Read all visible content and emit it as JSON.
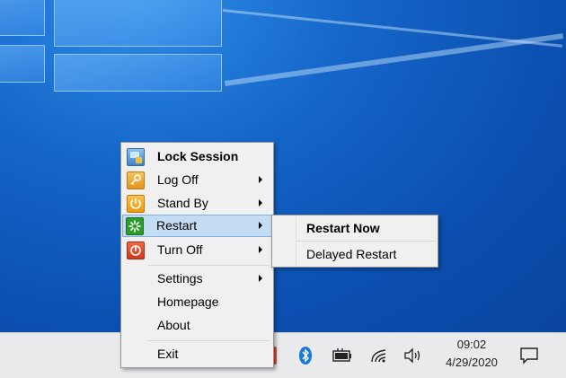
{
  "menu": {
    "items": [
      {
        "label": "Lock Session",
        "icon": "lock-session-icon"
      },
      {
        "label": "Log Off",
        "icon": "key-icon"
      },
      {
        "label": "Stand By",
        "icon": "power-icon"
      },
      {
        "label": "Restart",
        "icon": "restart-icon"
      },
      {
        "label": "Turn Off",
        "icon": "turn-off-icon"
      },
      {
        "label": "Settings"
      },
      {
        "label": "Homepage"
      },
      {
        "label": "About"
      },
      {
        "label": "Exit"
      }
    ]
  },
  "submenu": {
    "items": [
      {
        "label": "Restart Now"
      },
      {
        "label": "Delayed Restart"
      }
    ]
  },
  "taskbar": {
    "time": "09:02",
    "date": "4/29/2020"
  },
  "colors": {
    "highlight": "#c5dcf5",
    "desktop": "#1566c9",
    "taskbar": "#e9eaec"
  }
}
